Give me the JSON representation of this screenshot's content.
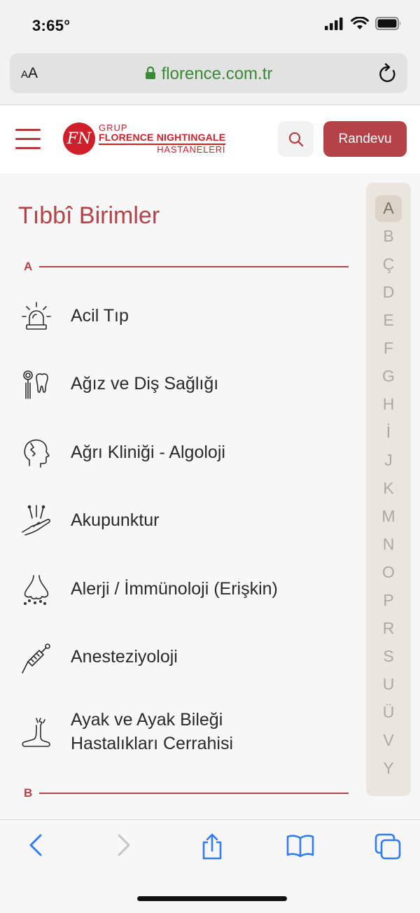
{
  "status_bar": {
    "time": "3:65°"
  },
  "browser": {
    "text_size_label": "AA",
    "url": "florence.com.tr"
  },
  "header": {
    "logo": {
      "mark": "FN",
      "grup": "GRUP",
      "name": "FLORENCE NIGHTINGALE",
      "sub": "HASTANELERİ"
    },
    "randevu_label": "Randevu"
  },
  "page": {
    "title": "Tıbbî Birimler",
    "sections": [
      {
        "letter": "A",
        "items": [
          {
            "label": "Acil Tıp",
            "icon": "siren-icon"
          },
          {
            "label": "Ağız ve Diş Sağlığı",
            "icon": "tooth-mirror-icon"
          },
          {
            "label": "Ağrı Kliniği - Algoloji",
            "icon": "head-pain-icon"
          },
          {
            "label": "Akupunktur",
            "icon": "acupuncture-hand-icon"
          },
          {
            "label": "Alerji / İmmünoloji (Erişkin)",
            "icon": "nose-allergy-icon"
          },
          {
            "label": "Anesteziyoloji",
            "icon": "syringe-icon"
          },
          {
            "label": "Ayak ve Ayak Bileği Hastalıkları Cerrahisi",
            "label_line1": "Ayak ve Ayak Bileği",
            "label_line2": "Hastalıkları Cerrahisi",
            "icon": "foot-pain-icon"
          }
        ]
      },
      {
        "letter": "B",
        "items": []
      }
    ]
  },
  "alphabet_index": {
    "letters": [
      "A",
      "B",
      "Ç",
      "D",
      "E",
      "F",
      "G",
      "H",
      "İ",
      "J",
      "K",
      "M",
      "N",
      "O",
      "P",
      "R",
      "S",
      "U",
      "Ü",
      "V",
      "Y"
    ],
    "selected": "A"
  },
  "colors": {
    "brand": "#b54247",
    "logo_red": "#d01f2a",
    "url_green": "#3a8a35",
    "ios_blue": "#2f7bf5"
  }
}
